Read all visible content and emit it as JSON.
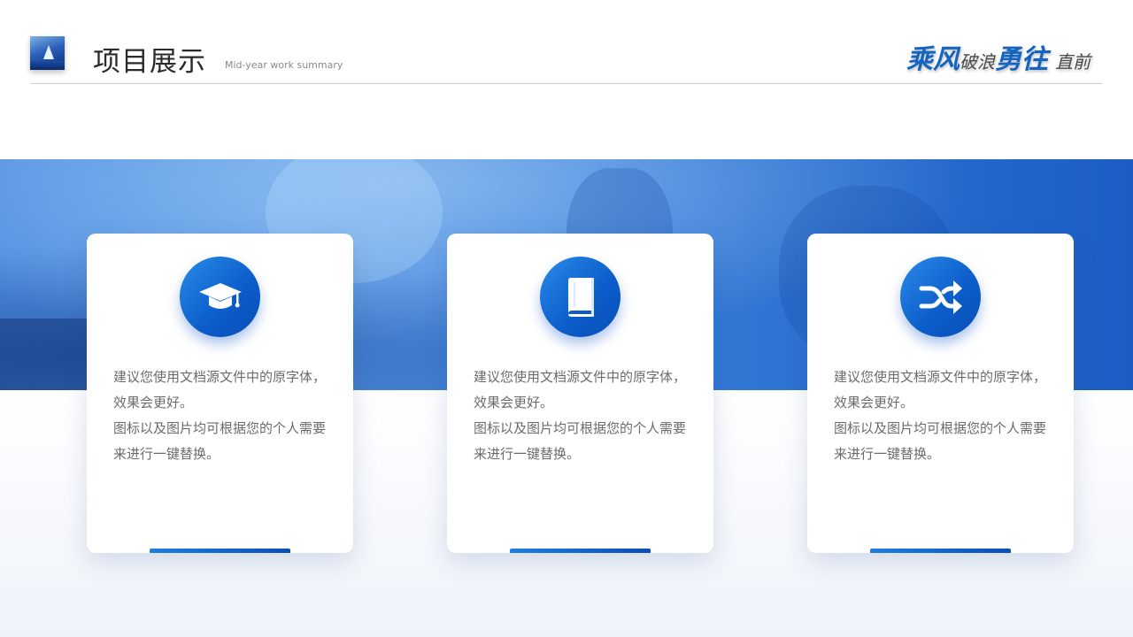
{
  "header": {
    "title": "项目展示",
    "subtitle": "Mid-year work summary",
    "slogan": {
      "part1": "乘风",
      "part2": "破浪",
      "part3": "勇往",
      "part4": "直前"
    }
  },
  "colors": {
    "accent": "#1565c0",
    "icon_gradient_start": "#2a8be8",
    "icon_gradient_end": "#0a4fb5",
    "body_text": "#6b6b6b"
  },
  "cards": [
    {
      "icon": "graduation-cap-icon",
      "line1": "建议您使用文档源文件中的原字体，效果会更好。",
      "line2": "图标以及图片均可根据您的个人需要来进行一键替换。"
    },
    {
      "icon": "book-icon",
      "line1": "建议您使用文档源文件中的原字体，效果会更好。",
      "line2": "图标以及图片均可根据您的个人需要来进行一键替换。"
    },
    {
      "icon": "shuffle-icon",
      "line1": "建议您使用文档源文件中的原字体，效果会更好。",
      "line2": "图标以及图片均可根据您的个人需要来进行一键替换。"
    }
  ]
}
